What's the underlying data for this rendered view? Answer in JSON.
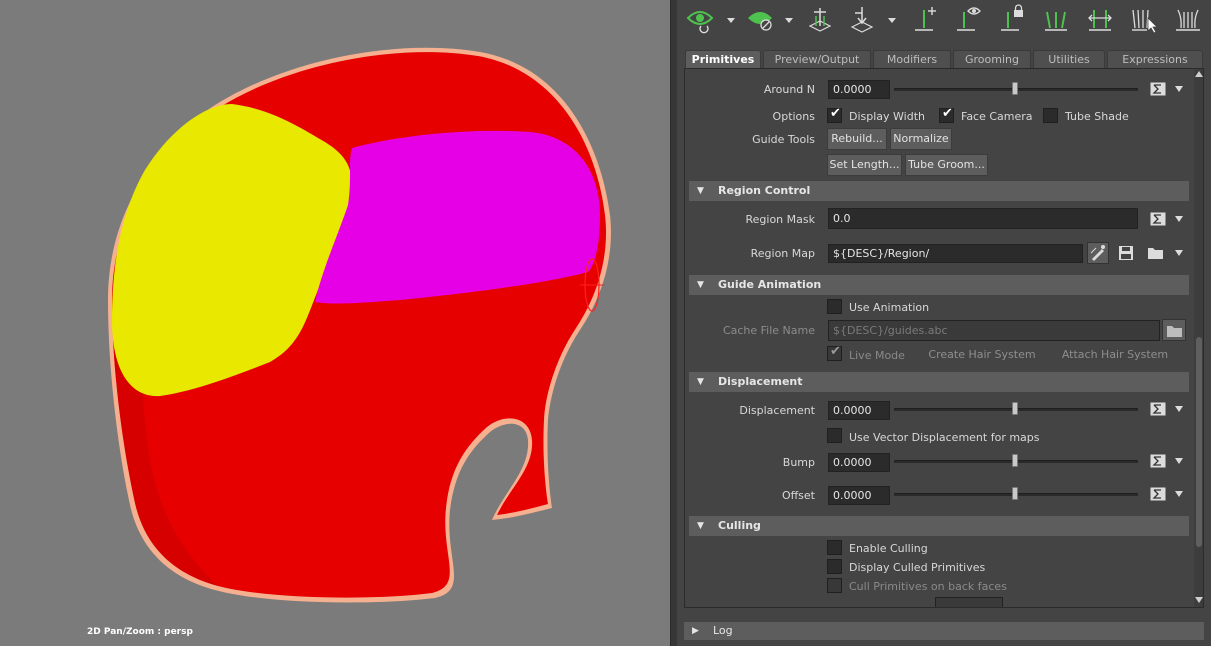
{
  "viewport": {
    "label": "2D Pan/Zoom : persp",
    "colors": {
      "background": "#7b7b7b",
      "head": "#e60000",
      "front_region": "#e8e800",
      "top_region": "#e600e6",
      "outline": "#f5b090"
    }
  },
  "toolbar": {
    "icons": [
      "guide-visibility-eye-icon",
      "region-eye-icon",
      "add-guide-icon",
      "move-guide-icon",
      "add-single-guide-icon",
      "view-guide-icon",
      "lock-guide-icon",
      "comb-guide-icon",
      "scale-guide-icon",
      "select-guide-icon",
      "flatten-guide-icon"
    ]
  },
  "tabs": [
    {
      "label": "Primitives",
      "active": true
    },
    {
      "label": "Preview/Output",
      "active": false
    },
    {
      "label": "Modifiers",
      "active": false
    },
    {
      "label": "Grooming",
      "active": false
    },
    {
      "label": "Utilities",
      "active": false
    },
    {
      "label": "Expressions",
      "active": false
    }
  ],
  "primitives": {
    "around_n": {
      "label": "Around N",
      "value": "0.0000",
      "slider": 0.5
    },
    "options": {
      "label": "Options",
      "display_width": {
        "label": "Display Width",
        "checked": true
      },
      "face_camera": {
        "label": "Face Camera",
        "checked": true
      },
      "tube_shade": {
        "label": "Tube Shade",
        "checked": false
      }
    },
    "guide_tools": {
      "label": "Guide Tools",
      "rebuild": "Rebuild...",
      "normalize": "Normalize",
      "set_length": "Set Length...",
      "tube_groom": "Tube Groom..."
    }
  },
  "region_control": {
    "title": "Region Control",
    "region_mask": {
      "label": "Region Mask",
      "value": "0.0"
    },
    "region_map": {
      "label": "Region Map",
      "value": "${DESC}/Region/"
    }
  },
  "guide_animation": {
    "title": "Guide Animation",
    "use_animation": {
      "label": "Use Animation",
      "checked": false
    },
    "cache_file": {
      "label": "Cache File Name",
      "value": "${DESC}/guides.abc"
    },
    "live_mode": {
      "label": "Live Mode",
      "checked": true
    },
    "create_hair_system": "Create Hair System",
    "attach_hair_system": "Attach Hair System"
  },
  "displacement": {
    "title": "Displacement",
    "displacement": {
      "label": "Displacement",
      "value": "0.0000",
      "slider": 0.5
    },
    "use_vector": {
      "label": "Use Vector Displacement for maps",
      "checked": false
    },
    "bump": {
      "label": "Bump",
      "value": "0.0000",
      "slider": 0.5
    },
    "offset": {
      "label": "Offset",
      "value": "0.0000",
      "slider": 0.5
    }
  },
  "culling": {
    "title": "Culling",
    "enable_culling": {
      "label": "Enable Culling",
      "checked": false
    },
    "display_culled": {
      "label": "Display Culled Primitives",
      "checked": false
    },
    "cull_back_faces": {
      "label": "Cull Primitives on back faces",
      "checked": false
    }
  },
  "log": {
    "label": "Log"
  }
}
